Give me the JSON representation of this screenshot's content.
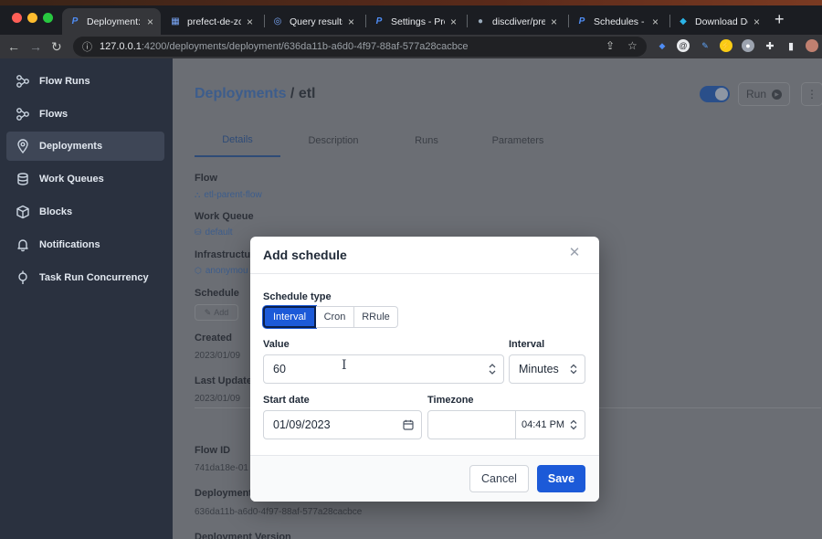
{
  "browser": {
    "tabs": [
      {
        "label": "Deployment: et",
        "favicon": "prefect-icon",
        "active": true
      },
      {
        "label": "prefect-de-zo",
        "favicon": "table-icon",
        "active": false
      },
      {
        "label": "Query results",
        "favicon": "query-icon",
        "active": false
      },
      {
        "label": "Settings - Pref",
        "favicon": "prefect-icon",
        "active": false
      },
      {
        "label": "discdiver/prefe",
        "favicon": "github-icon",
        "active": false
      },
      {
        "label": "Schedules - Pr",
        "favicon": "prefect-icon",
        "active": false
      },
      {
        "label": "Download Doc",
        "favicon": "docker-icon",
        "active": false
      }
    ],
    "url_host": "127.0.0.1",
    "url_path": ":4200/deployments/deployment/636da11b-a6d0-4f97-88af-577a28cacbce"
  },
  "sidebar": {
    "items": [
      {
        "label": "Flow Runs",
        "icon": "flow-runs-icon"
      },
      {
        "label": "Flows",
        "icon": "flows-icon"
      },
      {
        "label": "Deployments",
        "icon": "location-pin-icon",
        "active": true
      },
      {
        "label": "Work Queues",
        "icon": "database-icon"
      },
      {
        "label": "Blocks",
        "icon": "cube-icon"
      },
      {
        "label": "Notifications",
        "icon": "bell-icon"
      },
      {
        "label": "Task Run Concurrency",
        "icon": "pin-icon"
      }
    ]
  },
  "page": {
    "breadcrumb_root": "Deployments",
    "breadcrumb_sep": " / ",
    "breadcrumb_current": "etl",
    "run_label": "Run",
    "tabs": [
      "Details",
      "Description",
      "Runs",
      "Parameters"
    ],
    "details": {
      "flow_label": "Flow",
      "flow_value": "etl-parent-flow",
      "work_queue_label": "Work Queue",
      "work_queue_value": "default",
      "infrastructure_label": "Infrastructur",
      "infrastructure_value": "anonymou",
      "schedule_label": "Schedule",
      "schedule_add": "Add",
      "created_label": "Created",
      "created_value": "2023/01/09",
      "last_updated_label": "Last Update",
      "last_updated_value": "2023/01/09",
      "flow_id_label": "Flow ID",
      "flow_id_value": "741da18e-01",
      "deployment_id_label": "Deployment",
      "deployment_id_value": "636da11b-a6d0-4f97-88af-577a28cacbce",
      "deployment_version_label": "Deployment Version"
    }
  },
  "modal": {
    "title": "Add schedule",
    "schedule_type_label": "Schedule type",
    "schedule_types": [
      "Interval",
      "Cron",
      "RRule"
    ],
    "selected_type": "Interval",
    "value_label": "Value",
    "value": "60",
    "interval_label": "Interval",
    "interval_value": "Minutes",
    "start_date_label": "Start date",
    "start_date_value": "01/09/2023",
    "timezone_label": "Timezone",
    "timezone_value": "",
    "time_value": "04:41 PM",
    "cancel_label": "Cancel",
    "save_label": "Save"
  },
  "colors": {
    "accent": "#1c5ad8",
    "sidebar_bg": "#2a313f",
    "overlay_bg": "#6b6e74"
  }
}
